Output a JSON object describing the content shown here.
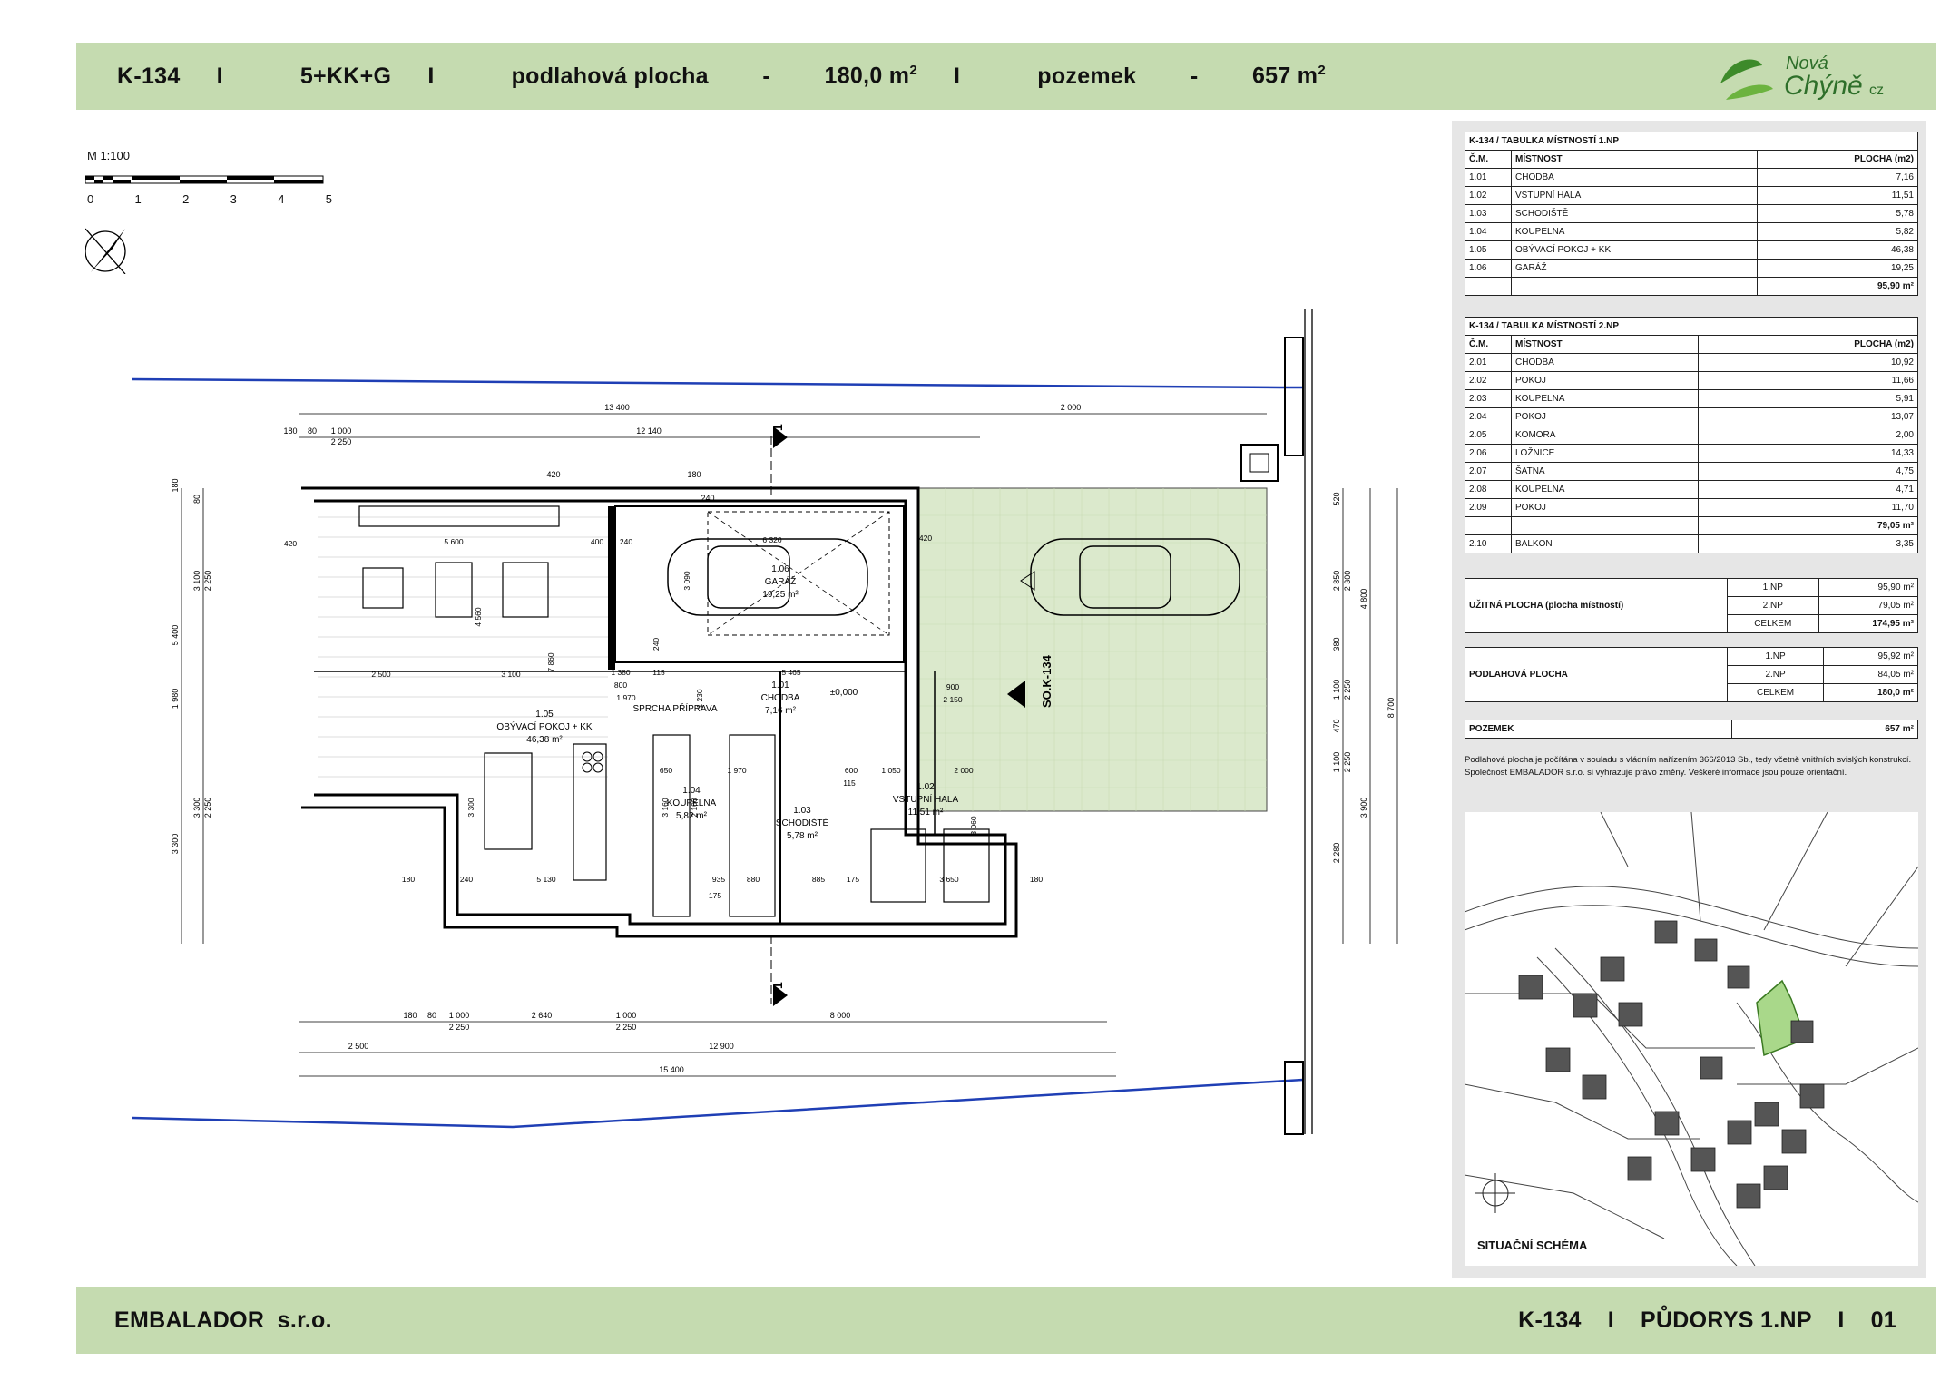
{
  "header": {
    "code": "K-134",
    "layout": "5+KK+G",
    "floor_label": "podlahová plocha",
    "floor_value": "180,0 m",
    "floor_sup": "2",
    "plot_label": "pozemek",
    "plot_value": "657 m",
    "plot_sup": "2",
    "sep": "I",
    "logo_top": "Nová",
    "logo_main": "Chýně",
    "logo_tld": "cz"
  },
  "scale": {
    "label": "M 1:100",
    "ticks": [
      "0",
      "1",
      "2",
      "3",
      "4",
      "5"
    ]
  },
  "plan": {
    "rooms": [
      {
        "num": "1.05",
        "name": "OBÝVACÍ POKOJ + KK",
        "area": "46,38 m²"
      },
      {
        "num": "1.06",
        "name": "GARÁŽ",
        "area": "19,25 m²"
      },
      {
        "num": "1.01",
        "name": "CHODBA",
        "area": "7,16 m²"
      },
      {
        "num": "1.04",
        "name": "KOUPELNA",
        "area": "5,82 m²"
      },
      {
        "num": "1.03",
        "name": "SCHODIŠTĚ",
        "area": "5,78 m²"
      },
      {
        "num": "1.02",
        "name": "VSTUPNÍ HALA",
        "area": "11,51 m²"
      }
    ],
    "sprcha": "SPRCHA PŘÍPRAVA",
    "level": "±0,000",
    "section": "SO.K-134",
    "cut": "1",
    "dims_top": [
      "13 400",
      "2 000",
      "12 140",
      "180",
      "80",
      "1 000",
      "2 250",
      "420",
      "180",
      "240"
    ],
    "dims_bottom": [
      "180",
      "80",
      "1 000",
      "2 250",
      "2 640",
      "1 000",
      "2 250",
      "8 000",
      "2 500",
      "12 900",
      "15 400"
    ],
    "dims_left": [
      "5 400",
      "1 980",
      "3 300",
      "180",
      "80",
      "3 100",
      "2 250",
      "3 300",
      "2 250"
    ],
    "dims_right": [
      "520",
      "2 850",
      "2 300",
      "4 800",
      "380",
      "1 100",
      "2 250",
      "470",
      "1 100",
      "2 250",
      "3 900",
      "2 280",
      "8 700"
    ],
    "dims_inner": [
      "420",
      "5 600",
      "400",
      "240",
      "6 320",
      "420",
      "3 090",
      "4 560",
      "7 860",
      "240",
      "2 500",
      "3 100",
      "1 380",
      "800",
      "1 970",
      "115",
      "5 465",
      "1 230",
      "900",
      "2 150",
      "650",
      "1 970",
      "2 100",
      "3 160",
      "935",
      "880",
      "885",
      "600",
      "1 050",
      "2 000",
      "115",
      "175",
      "3 060",
      "240",
      "5 130",
      "180",
      "3 650",
      "175",
      "180",
      "3 300"
    ]
  },
  "table1": {
    "title": "K-134 / TABULKA MÍSTNOSTÍ 1.NP",
    "head": [
      "Č.M.",
      "MÍSTNOST",
      "PLOCHA (m2)"
    ],
    "rows": [
      [
        "1.01",
        "CHODBA",
        "7,16"
      ],
      [
        "1.02",
        "VSTUPNÍ HALA",
        "11,51"
      ],
      [
        "1.03",
        "SCHODIŠTĚ",
        "5,78"
      ],
      [
        "1.04",
        "KOUPELNA",
        "5,82"
      ],
      [
        "1.05",
        "OBÝVACÍ POKOJ + KK",
        "46,38"
      ],
      [
        "1.06",
        "GARÁŽ",
        "19,25"
      ]
    ],
    "total": "95,90 m²"
  },
  "table2": {
    "title": "K-134 / TABULKA MÍSTNOSTÍ 2.NP",
    "head": [
      "Č.M.",
      "MÍSTNOST",
      "PLOCHA (m2)"
    ],
    "rows": [
      [
        "2.01",
        "CHODBA",
        "10,92"
      ],
      [
        "2.02",
        "POKOJ",
        "11,66"
      ],
      [
        "2.03",
        "KOUPELNA",
        "5,91"
      ],
      [
        "2.04",
        "POKOJ",
        "13,07"
      ],
      [
        "2.05",
        "KOMORA",
        "2,00"
      ],
      [
        "2.06",
        "LOŽNICE",
        "14,33"
      ],
      [
        "2.07",
        "ŠATNA",
        "4,75"
      ],
      [
        "2.08",
        "KOUPELNA",
        "4,71"
      ],
      [
        "2.09",
        "POKOJ",
        "11,70"
      ]
    ],
    "total": "79,05 m²",
    "extra": [
      "2.10",
      "BALKON",
      "3,35"
    ]
  },
  "uzitna": {
    "label": "UŽITNÁ PLOCHA  (plocha místností)",
    "rows": [
      [
        "1.NP",
        "95,90 m²"
      ],
      [
        "2.NP",
        "79,05 m²"
      ],
      [
        "CELKEM",
        "174,95 m²"
      ]
    ]
  },
  "podlahova": {
    "label": "PODLAHOVÁ PLOCHA",
    "rows": [
      [
        "1.NP",
        "95,92 m²"
      ],
      [
        "2.NP",
        "84,05 m²"
      ],
      [
        "CELKEM",
        "180,0 m²"
      ]
    ]
  },
  "pozemek": {
    "label": "POZEMEK",
    "value": "657 m²"
  },
  "note": [
    "Podlahová plocha je počítána v souladu s vládním nařízením 366/2013 Sb., tedy včetně vnitřních svislých konstrukcí.",
    "Společnost EMBALADOR s.r.o. si vyhrazuje právo změny. Veškeré informace jsou pouze orientační."
  ],
  "map_label": "SITUAČNÍ SCHÉMA",
  "footer": {
    "company": "EMBALADOR  s.r.o.",
    "code": "K-134",
    "sheet": "PŮDORYS 1.NP",
    "num": "01",
    "sep": "I"
  },
  "colors": {
    "band": "#c5dbb0",
    "paving": "#dbe9cc",
    "boundary": "#1f3fb5",
    "highlight": "#a9d88a"
  }
}
